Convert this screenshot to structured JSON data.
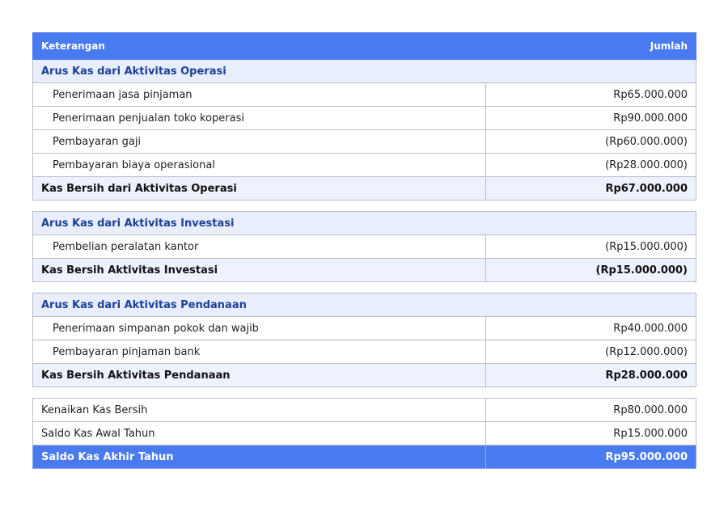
{
  "header": {
    "description": "Keterangan",
    "amount": "Jumlah"
  },
  "operasi": {
    "title": "Arus Kas dari Aktivitas Operasi",
    "items": [
      {
        "label": "Penerimaan jasa pinjaman",
        "amount": "Rp65.000.000"
      },
      {
        "label": "Penerimaan penjualan toko koperasi",
        "amount": "Rp90.000.000"
      },
      {
        "label": "Pembayaran gaji",
        "amount": "(Rp60.000.000)"
      },
      {
        "label": "Pembayaran biaya operasional",
        "amount": "(Rp28.000.000)"
      }
    ],
    "total_label": "Kas Bersih dari Aktivitas Operasi",
    "total_amount": "Rp67.000.000"
  },
  "investasi": {
    "title": "Arus Kas dari Aktivitas Investasi",
    "items": [
      {
        "label": "Pembelian peralatan kantor",
        "amount": "(Rp15.000.000)"
      }
    ],
    "total_label": "Kas Bersih Aktivitas Investasi",
    "total_amount": "(Rp15.000.000)"
  },
  "pendanaan": {
    "title": "Arus Kas dari Aktivitas Pendanaan",
    "items": [
      {
        "label": "Penerimaan simpanan pokok dan wajib",
        "amount": "Rp40.000.000"
      },
      {
        "label": "Pembayaran pinjaman bank",
        "amount": "(Rp12.000.000)"
      }
    ],
    "total_label": "Kas Bersih Aktivitas Pendanaan",
    "total_amount": "Rp28.000.000"
  },
  "summary": {
    "items": [
      {
        "label": "Kenaikan Kas Bersih",
        "amount": "Rp80.000.000"
      },
      {
        "label": "Saldo Kas Awal Tahun",
        "amount": "Rp15.000.000"
      }
    ],
    "final_label": "Saldo Kas Akhir Tahun",
    "final_amount": "Rp95.000.000"
  },
  "colors": {
    "accent": "#4a7aef",
    "section_bg": "#e8eefd",
    "section_text": "#1d3f9a",
    "subtotal_bg": "#eef2fd"
  }
}
